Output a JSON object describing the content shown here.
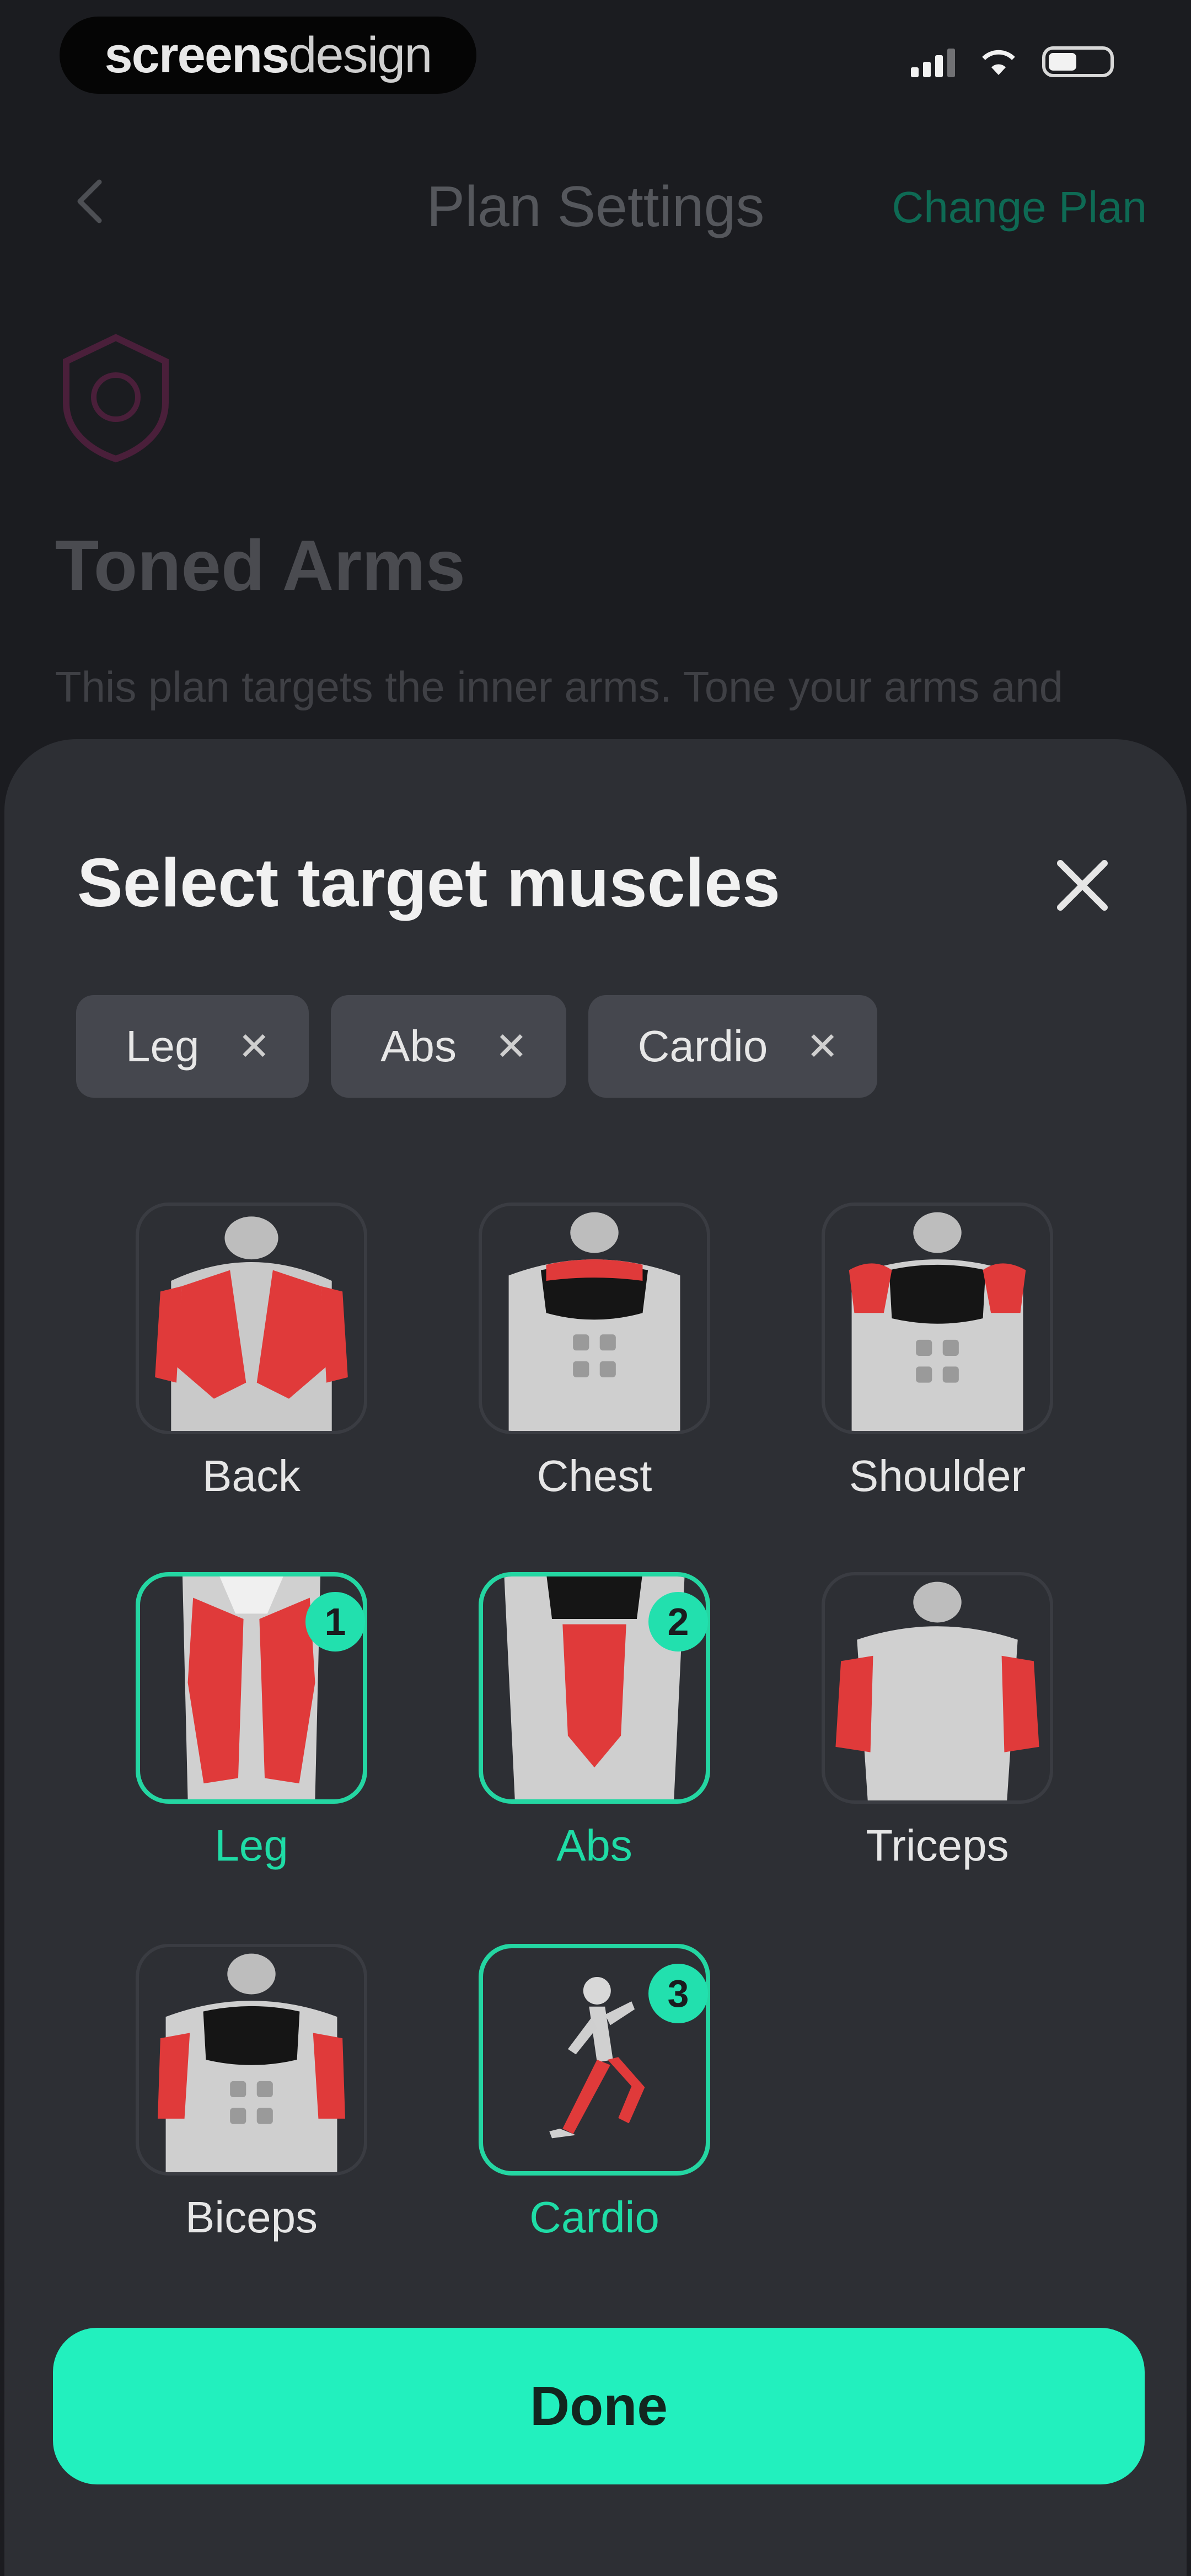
{
  "status_bar": {
    "brand_bold": "screens",
    "brand_light": "design"
  },
  "nav": {
    "title": "Plan Settings",
    "action": "Change Plan"
  },
  "plan": {
    "title": "Toned Arms",
    "description": "This plan targets the inner arms. Tone your arms and"
  },
  "sheet": {
    "title": "Select target muscles",
    "chips": [
      {
        "label": "Leg"
      },
      {
        "label": "Abs"
      },
      {
        "label": "Cardio"
      }
    ],
    "muscles": [
      {
        "label": "Back",
        "selected": false,
        "badge": ""
      },
      {
        "label": "Chest",
        "selected": false,
        "badge": ""
      },
      {
        "label": "Shoulder",
        "selected": false,
        "badge": ""
      },
      {
        "label": "Leg",
        "selected": true,
        "badge": "1"
      },
      {
        "label": "Abs",
        "selected": true,
        "badge": "2"
      },
      {
        "label": "Triceps",
        "selected": false,
        "badge": ""
      },
      {
        "label": "Biceps",
        "selected": false,
        "badge": ""
      },
      {
        "label": "Cardio",
        "selected": true,
        "badge": "3"
      }
    ],
    "done_label": "Done"
  },
  "colors": {
    "accent": "#22f0be",
    "highlight_muscle": "#e03a3a",
    "sheet_bg": "#2d2f34"
  }
}
